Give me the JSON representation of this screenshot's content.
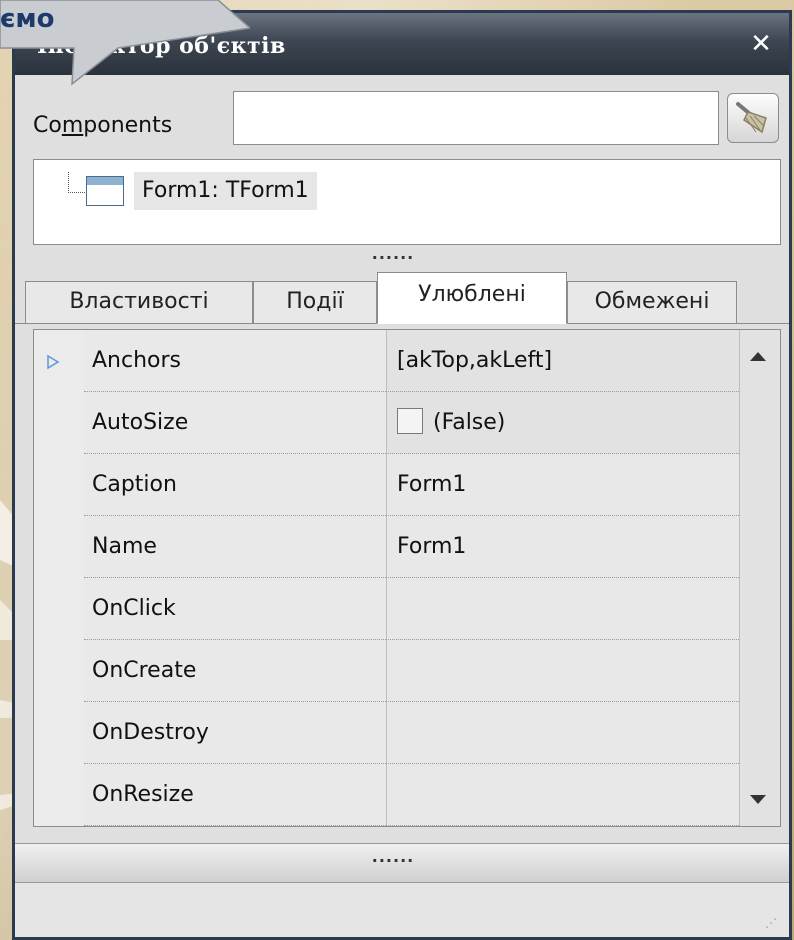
{
  "callout": {
    "text": "ємо"
  },
  "window": {
    "title": "Інспектор об'єктів",
    "close_label": "✕"
  },
  "components": {
    "label_pre": "Co",
    "label_underlined": "m",
    "label_post": "ponents",
    "value": "",
    "brush_icon": "broom-icon"
  },
  "tree": {
    "node_label": "Form1: TForm1",
    "node_icon": "form-icon"
  },
  "splitter": {
    "dots": "......"
  },
  "tabs": [
    {
      "label": "Властивості",
      "active": false
    },
    {
      "label": "Події",
      "active": false
    },
    {
      "label": "Улюблені",
      "active": true
    },
    {
      "label": "Обмежені",
      "active": false
    }
  ],
  "properties": [
    {
      "name": "Anchors",
      "value": "[akTop,akLeft]",
      "selected": true
    },
    {
      "name": "AutoSize",
      "value": "(False)",
      "checkbox": true
    },
    {
      "name": "Caption",
      "value": "Form1"
    },
    {
      "name": "Name",
      "value": "Form1"
    },
    {
      "name": "OnClick",
      "value": ""
    },
    {
      "name": "OnCreate",
      "value": ""
    },
    {
      "name": "OnDestroy",
      "value": ""
    },
    {
      "name": "OnResize",
      "value": ""
    }
  ],
  "colors": {
    "titlebar": "#3d4652",
    "background": "#d8c7a3",
    "callout_text": "#1d3a6b"
  }
}
